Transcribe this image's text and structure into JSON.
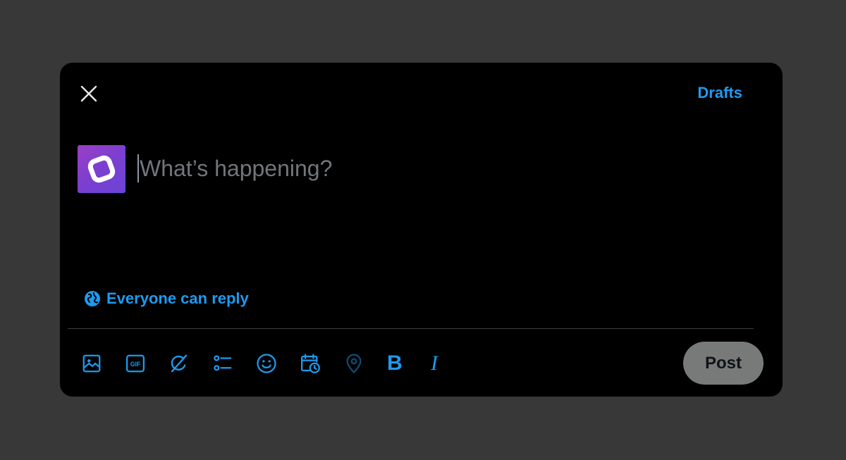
{
  "dialog": {
    "close_icon": "close-icon",
    "drafts_label": "Drafts"
  },
  "composer": {
    "avatar_icon": "app-logo-icon",
    "placeholder": "What’s happening?",
    "value": ""
  },
  "reply_setting": {
    "icon": "globe-icon",
    "label": "Everyone can reply"
  },
  "toolbar": {
    "tools": [
      {
        "name": "media",
        "icon": "image-icon"
      },
      {
        "name": "gif",
        "icon": "gif-icon",
        "text": "GIF"
      },
      {
        "name": "grok",
        "icon": "grok-icon"
      },
      {
        "name": "poll",
        "icon": "poll-icon"
      },
      {
        "name": "emoji",
        "icon": "emoji-icon"
      },
      {
        "name": "schedule",
        "icon": "schedule-icon"
      },
      {
        "name": "location",
        "icon": "location-icon",
        "disabled": true
      },
      {
        "name": "bold",
        "icon": "bold-icon",
        "text": "B"
      },
      {
        "name": "italic",
        "icon": "italic-icon",
        "text": "I"
      }
    ],
    "post_label": "Post"
  },
  "colors": {
    "accent": "#1d9bf0",
    "background": "#000000",
    "backdrop": "#383838",
    "post_button_disabled": "#787a7a"
  }
}
